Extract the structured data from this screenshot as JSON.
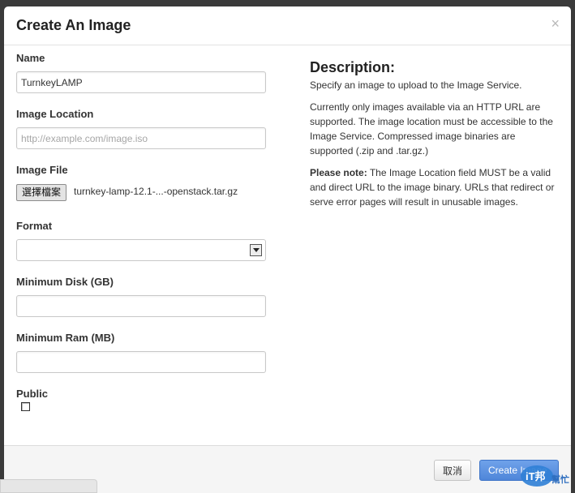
{
  "modal": {
    "title": "Create An Image",
    "close": "×"
  },
  "form": {
    "name": {
      "label": "Name",
      "value": "TurnkeyLAMP"
    },
    "image_location": {
      "label": "Image Location",
      "placeholder": "http://example.com/image.iso"
    },
    "image_file": {
      "label": "Image File",
      "button_label": "選擇檔案",
      "file_name": "turnkey-lamp-12.1-...-openstack.tar.gz"
    },
    "format": {
      "label": "Format",
      "value": ""
    },
    "minimum_disk": {
      "label": "Minimum Disk (GB)",
      "value": ""
    },
    "minimum_ram": {
      "label": "Minimum Ram (MB)",
      "value": ""
    },
    "public": {
      "label": "Public",
      "checked": false
    }
  },
  "description": {
    "title": "Description:",
    "p1": "Specify an image to upload to the Image Service.",
    "p2": "Currently only images available via an HTTP URL are supported. The image location must be accessible to the Image Service. Compressed image binaries are supported (.zip and .tar.gz.)",
    "note_label": "Please note:",
    "note_text": " The Image Location field MUST be a valid and direct URL to the image binary. URLs that redirect or serve error pages will result in unusable images."
  },
  "footer": {
    "cancel_label": "取消",
    "create_label": "Create Image"
  },
  "watermark": {
    "line1": "iT邦",
    "line2": "幫忙"
  },
  "colors": {
    "primary_button": "#4f86d9",
    "backdrop": "#3a3a3a"
  }
}
